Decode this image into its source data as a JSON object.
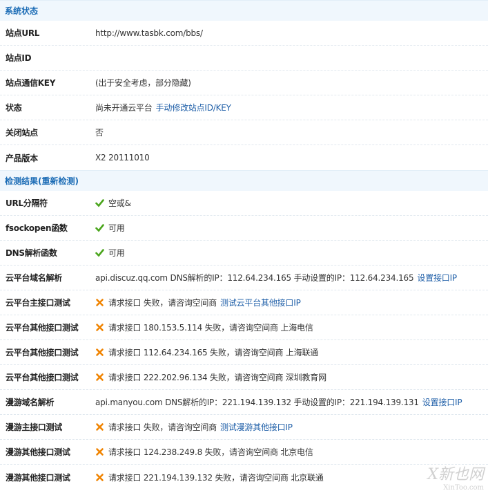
{
  "system_status": {
    "title": "系统状态",
    "rows": [
      {
        "label": "站点URL",
        "value": "http://www.tasbk.com/bbs/"
      },
      {
        "label": "站点ID",
        "value": ""
      },
      {
        "label": "站点通信KEY",
        "value": "(出于安全考虑，部分隐藏)"
      },
      {
        "label": "状态",
        "value": "尚未开通云平台",
        "link": "手动修改站点ID/KEY"
      },
      {
        "label": "关闭站点",
        "value": "否"
      },
      {
        "label": "产品版本",
        "value": "X2 20111010"
      }
    ]
  },
  "check_results": {
    "title": "检测结果",
    "recheck_prefix": "(",
    "recheck_link": "重新检测",
    "recheck_suffix": ")",
    "rows": [
      {
        "label": "URL分隔符",
        "status": "ok",
        "text": "空或&"
      },
      {
        "label": "fsockopen函数",
        "status": "ok",
        "text": "可用"
      },
      {
        "label": "DNS解析函数",
        "status": "ok",
        "text": "可用"
      },
      {
        "label": "云平台域名解析",
        "status": "none",
        "text": "api.discuz.qq.com DNS解析的IP：112.64.234.165 手动设置的IP：112.64.234.165",
        "link": "设置接口IP"
      },
      {
        "label": "云平台主接口测试",
        "status": "fail",
        "text": "请求接口 失败，请咨询空间商",
        "link": "测试云平台其他接口IP"
      },
      {
        "label": "云平台其他接口测试",
        "status": "fail",
        "text": "请求接口 180.153.5.114 失败，请咨询空间商 上海电信"
      },
      {
        "label": "云平台其他接口测试",
        "status": "fail",
        "text": "请求接口 112.64.234.165 失败，请咨询空间商 上海联通"
      },
      {
        "label": "云平台其他接口测试",
        "status": "fail",
        "text": "请求接口 222.202.96.134 失败，请咨询空间商 深圳教育网"
      },
      {
        "label": "漫游域名解析",
        "status": "none",
        "text": "api.manyou.com DNS解析的IP：221.194.139.132 手动设置的IP：221.194.139.131",
        "link": "设置接口IP"
      },
      {
        "label": "漫游主接口测试",
        "status": "fail",
        "text": "请求接口 失败，请咨询空间商",
        "link": "测试漫游其他接口IP"
      },
      {
        "label": "漫游其他接口测试",
        "status": "fail",
        "text": "请求接口 124.238.249.8 失败，请咨询空间商 北京电信"
      },
      {
        "label": "漫游其他接口测试",
        "status": "fail",
        "text": "请求接口 221.194.139.132 失败，请咨询空间商 北京联通"
      }
    ]
  },
  "watermark": {
    "brand": "X新也网",
    "site": "XinToo.com"
  },
  "colors": {
    "ok": "#4aa51c",
    "fail": "#f08300",
    "link": "#1f5fa8",
    "section_bg": "#f0f7fd"
  }
}
